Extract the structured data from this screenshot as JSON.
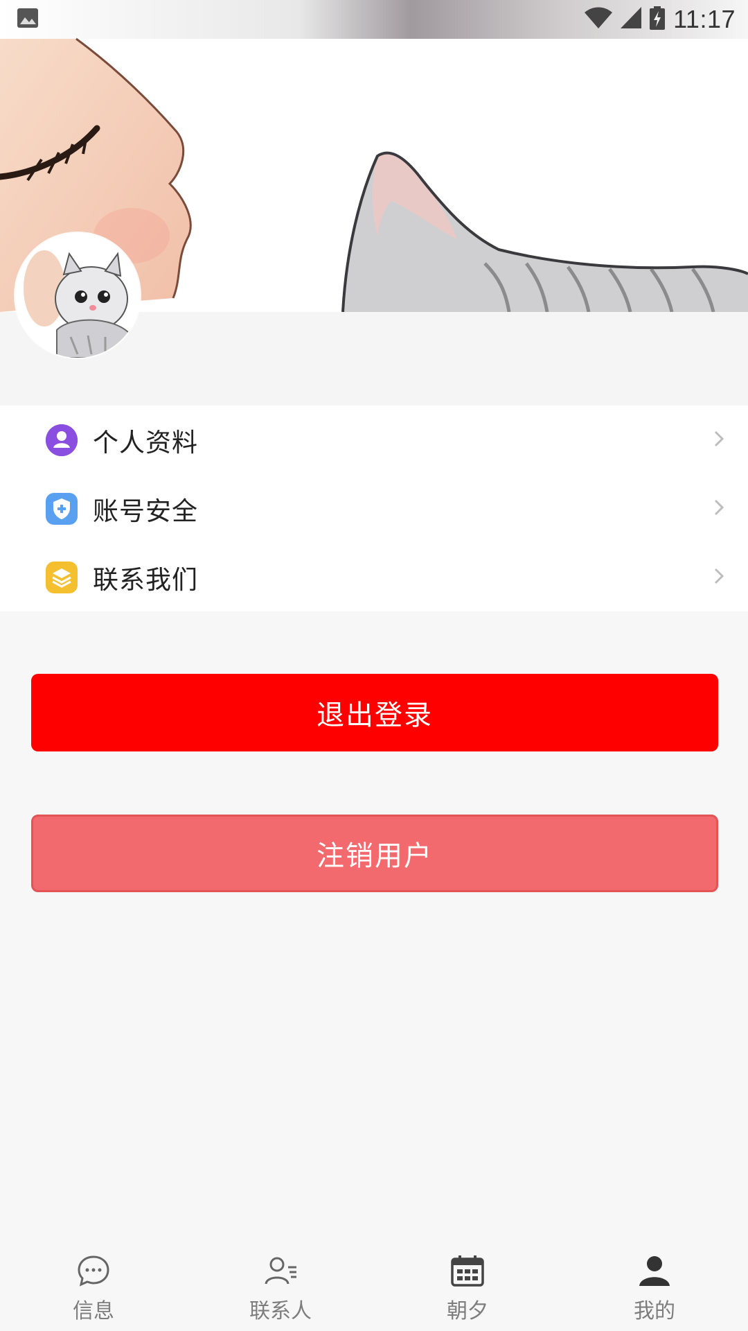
{
  "status_bar": {
    "time": "11:17",
    "icons": [
      "gallery-notification-icon",
      "wifi-icon",
      "signal-icon",
      "battery-charging-icon"
    ]
  },
  "profile": {
    "name": "",
    "subtitle": ""
  },
  "menu": {
    "items": [
      {
        "label": "个人资料",
        "icon": "person-icon",
        "color": "#8a4fe0"
      },
      {
        "label": "账号安全",
        "icon": "shield-icon",
        "color": "#5aa0f0"
      },
      {
        "label": "联系我们",
        "icon": "layers-icon",
        "color": "#f5c030"
      }
    ]
  },
  "buttons": {
    "logout_label": "退出登录",
    "deregister_label": "注销用户",
    "logout_color": "#ff0000",
    "deregister_color": "#f26a6d"
  },
  "tabbar": {
    "tabs": [
      {
        "label": "信息",
        "icon": "message-icon"
      },
      {
        "label": "联系人",
        "icon": "contacts-icon"
      },
      {
        "label": "朝夕",
        "icon": "calendar-icon"
      },
      {
        "label": "我的",
        "icon": "person-icon"
      }
    ]
  }
}
